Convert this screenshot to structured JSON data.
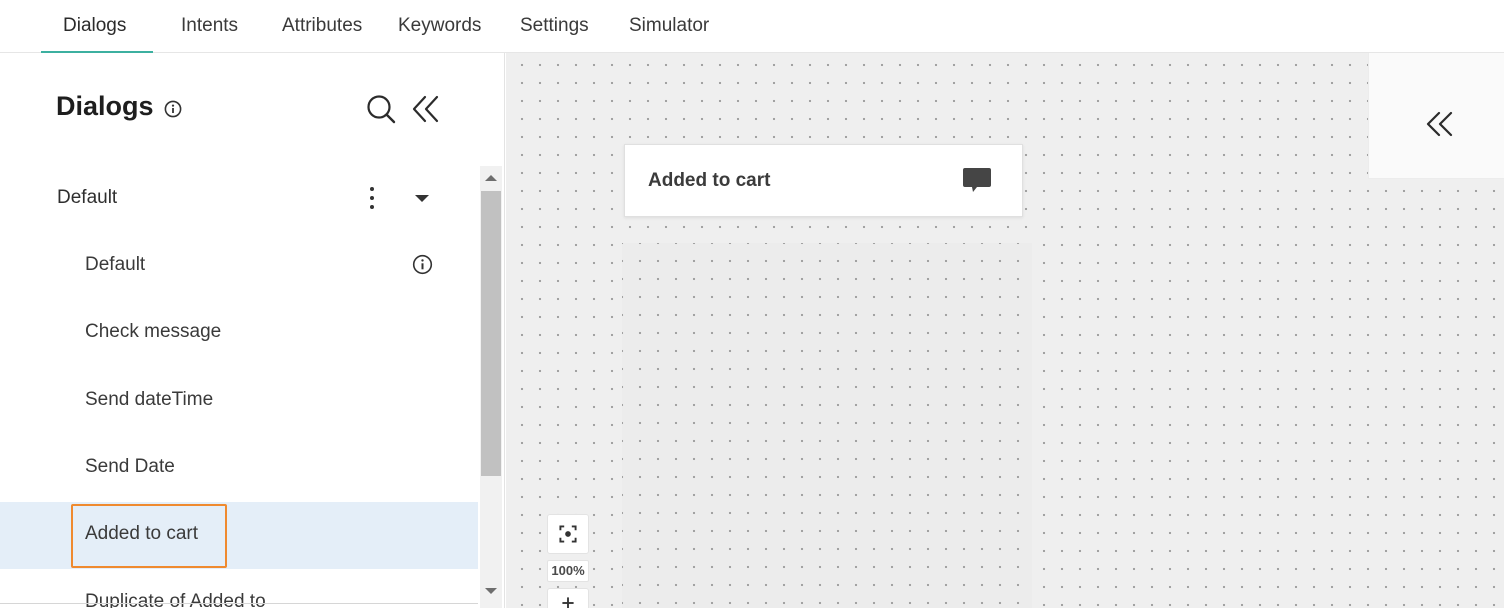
{
  "nav": {
    "tabs": [
      {
        "label": "Dialogs",
        "active": true
      },
      {
        "label": "Intents"
      },
      {
        "label": "Attributes"
      },
      {
        "label": "Keywords"
      },
      {
        "label": "Settings"
      },
      {
        "label": "Simulator"
      }
    ],
    "accent_color": "#3cb0a0"
  },
  "sidebar": {
    "title": "Dialogs",
    "title_icon": "info-icon",
    "search_icon": "search-icon",
    "collapse_icon": "double-chevron-left-icon",
    "group": {
      "label": "Default",
      "more_icon": "vertical-dots-icon",
      "expand_icon": "caret-down-icon"
    },
    "items": [
      {
        "label": "Default",
        "icon": "info-icon"
      },
      {
        "label": "Check message"
      },
      {
        "label": "Send dateTime"
      },
      {
        "label": "Send Date"
      },
      {
        "label": "Added to cart",
        "selected": true
      },
      {
        "label": "Duplicate of Added to"
      }
    ],
    "selected_bg": "#e4eef8",
    "focus_color": "#ef8a2f"
  },
  "canvas": {
    "node": {
      "title": "Added to cart",
      "icon": "chat-bubble-icon"
    },
    "right_panel_icon": "double-chevron-left-icon",
    "zoom": {
      "fit_icon": "fit-screen-icon",
      "level": "100%",
      "zoom_in_icon": "plus-icon"
    }
  }
}
